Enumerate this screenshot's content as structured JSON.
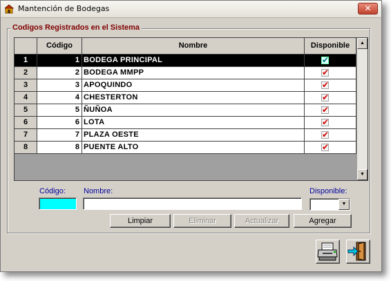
{
  "window": {
    "title": "Mantención de Bodegas",
    "close_glyph": "✕"
  },
  "group": {
    "title": "Codigos Registrados en el Sistema"
  },
  "grid": {
    "columns": [
      "Código",
      "Nombre",
      "Disponible"
    ],
    "rows": [
      {
        "n": "1",
        "code": "1",
        "name": "BODEGA PRINCIPAL",
        "available": true,
        "selected": true
      },
      {
        "n": "2",
        "code": "2",
        "name": "BODEGA MMPP",
        "available": true
      },
      {
        "n": "3",
        "code": "3",
        "name": "APOQUINDO",
        "available": true
      },
      {
        "n": "4",
        "code": "4",
        "name": "CHESTERTON",
        "available": true
      },
      {
        "n": "5",
        "code": "5",
        "name": "ÑUÑOA",
        "available": true
      },
      {
        "n": "6",
        "code": "6",
        "name": "LOTA",
        "available": true
      },
      {
        "n": "7",
        "code": "7",
        "name": "PLAZA OESTE",
        "available": true
      },
      {
        "n": "8",
        "code": "8",
        "name": "PUENTE ALTO",
        "available": true
      }
    ],
    "check_glyph": "✔",
    "scroll_up_glyph": "▲",
    "scroll_down_glyph": "▼"
  },
  "form": {
    "codigo_label": "Código:",
    "nombre_label": "Nombre:",
    "disponible_label": "Disponible:",
    "codigo_value": "",
    "nombre_value": "",
    "dropdown_glyph": "▼"
  },
  "buttons": {
    "limpiar": "Limpiar",
    "eliminar": "Eliminar",
    "actualizar": "Actualizar",
    "agregar": "Agregar"
  },
  "icons": {
    "app": "warehouse-app-icon",
    "print": "printer-icon",
    "exit": "exit-door-icon"
  },
  "colors": {
    "accent_label": "#00009c",
    "group_title": "#800000",
    "codigo_field": "#00ffff",
    "selected_row": "#000000"
  }
}
